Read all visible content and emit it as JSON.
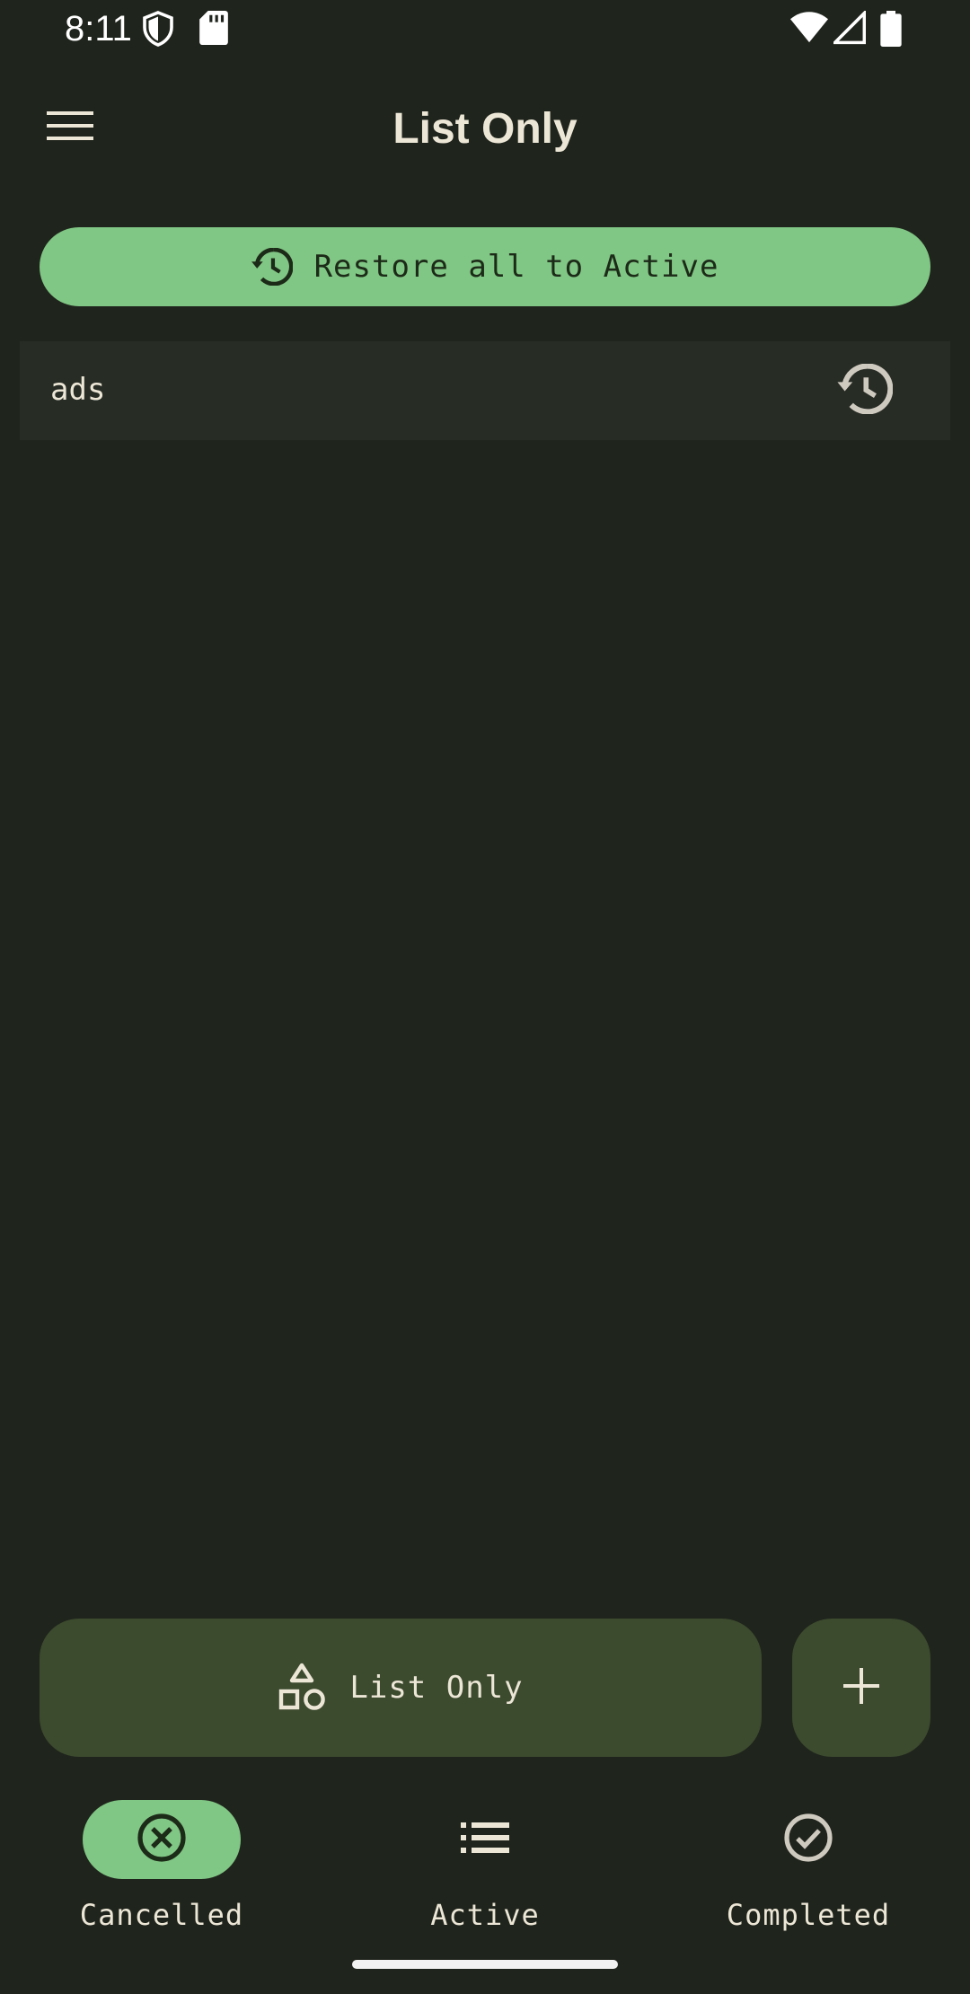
{
  "status_bar": {
    "time": "8:11"
  },
  "app_bar": {
    "title": "List Only",
    "menu_icon": "hamburger-menu-icon"
  },
  "restore_all": {
    "label": "Restore all to Active",
    "icon": "history-icon"
  },
  "items": [
    {
      "text": "ads",
      "action_icon": "history-icon"
    }
  ],
  "list_selector": {
    "label": "List Only",
    "icon": "shapes-icon"
  },
  "add_button": {
    "icon": "plus-icon"
  },
  "bottom_nav": [
    {
      "label": "Cancelled",
      "icon": "cancel-circle-icon",
      "selected": true
    },
    {
      "label": "Active",
      "icon": "list-icon",
      "selected": false
    },
    {
      "label": "Completed",
      "icon": "check-circle-icon",
      "selected": false
    }
  ],
  "colors": {
    "background": "#1f241c",
    "accent": "#80c684",
    "surface": "#3c4a2e",
    "list_item": "#272c25"
  }
}
